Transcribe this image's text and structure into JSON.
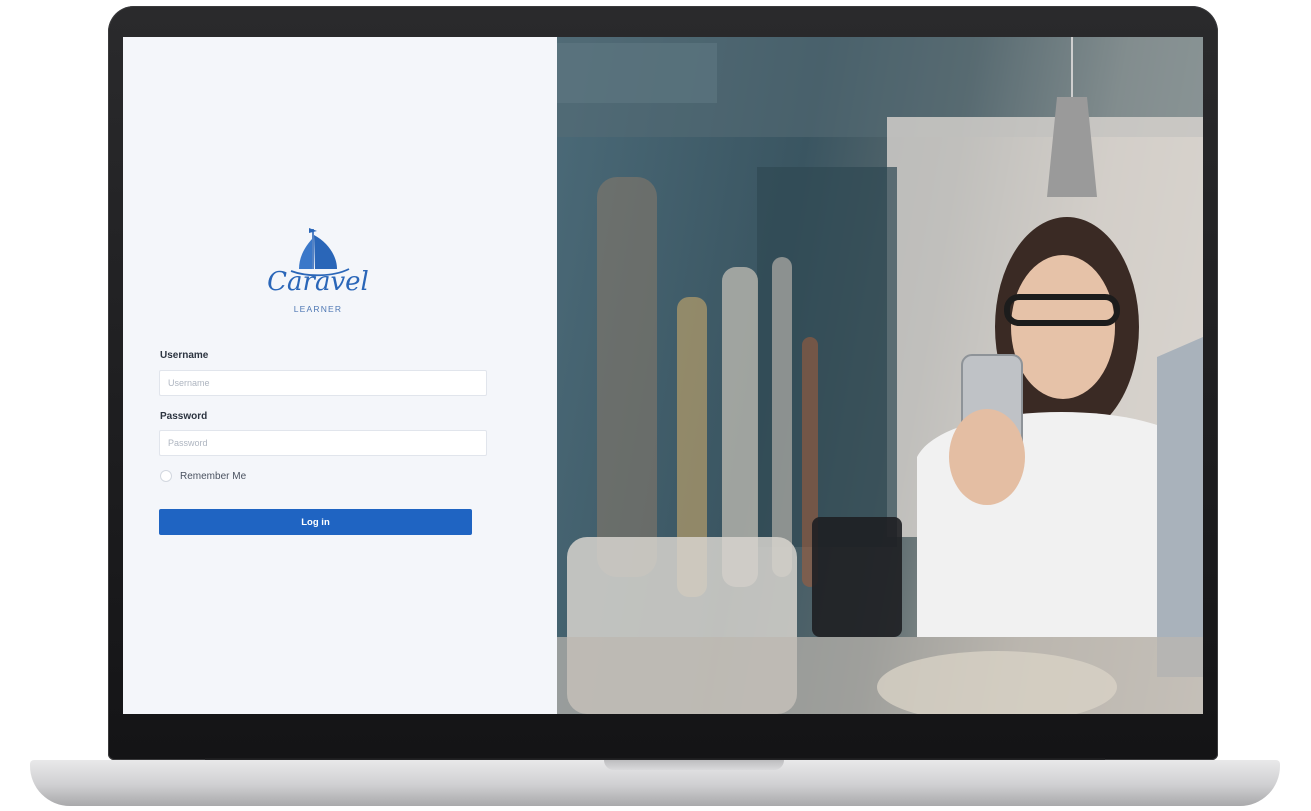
{
  "brand": {
    "name": "Caravel",
    "subtitle": "LEARNER"
  },
  "login": {
    "username_label": "Username",
    "username_placeholder": "Username",
    "password_label": "Password",
    "password_placeholder": "Password",
    "remember_label": "Remember Me",
    "login_button": "Log in"
  },
  "colors": {
    "primary": "#1f64c2",
    "logo_blue": "#2a66b8",
    "panel_bg": "#f4f6fa"
  }
}
